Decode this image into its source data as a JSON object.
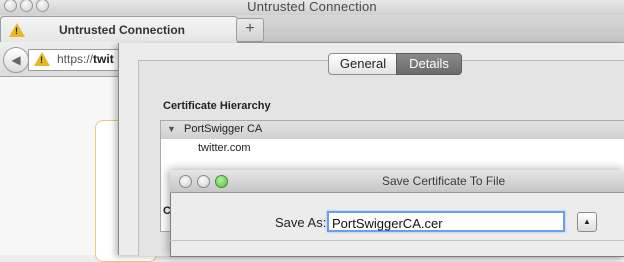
{
  "browser": {
    "window_title": "Untrusted Connection",
    "tab": {
      "label": "Untrusted Connection"
    },
    "new_tab_label": "+",
    "back_icon": "back-arrow-icon",
    "url": {
      "scheme": "https://",
      "host_partial": "twit"
    }
  },
  "certificate_sheet": {
    "tabs": [
      {
        "label": "General",
        "selected": false
      },
      {
        "label": "Details",
        "selected": true
      }
    ],
    "hierarchy_heading": "Certificate Hierarchy",
    "hierarchy": [
      {
        "label": "PortSwigger CA",
        "expanded": true
      },
      {
        "label": "twitter.com"
      }
    ],
    "truncated_heading_letter": "C"
  },
  "save_dialog": {
    "title": "Save Certificate To File",
    "save_as_label": "Save As:",
    "filename": "PortSwiggerCA.cer",
    "expand_icon": "disclosure-up-icon"
  },
  "colors": {
    "warning": "#e8b820",
    "focus_ring": "#6aa0e8",
    "close_red": "#e85a4f",
    "minimize_yellow": "#f0b940",
    "zoom_green": "#4fbf3d"
  }
}
